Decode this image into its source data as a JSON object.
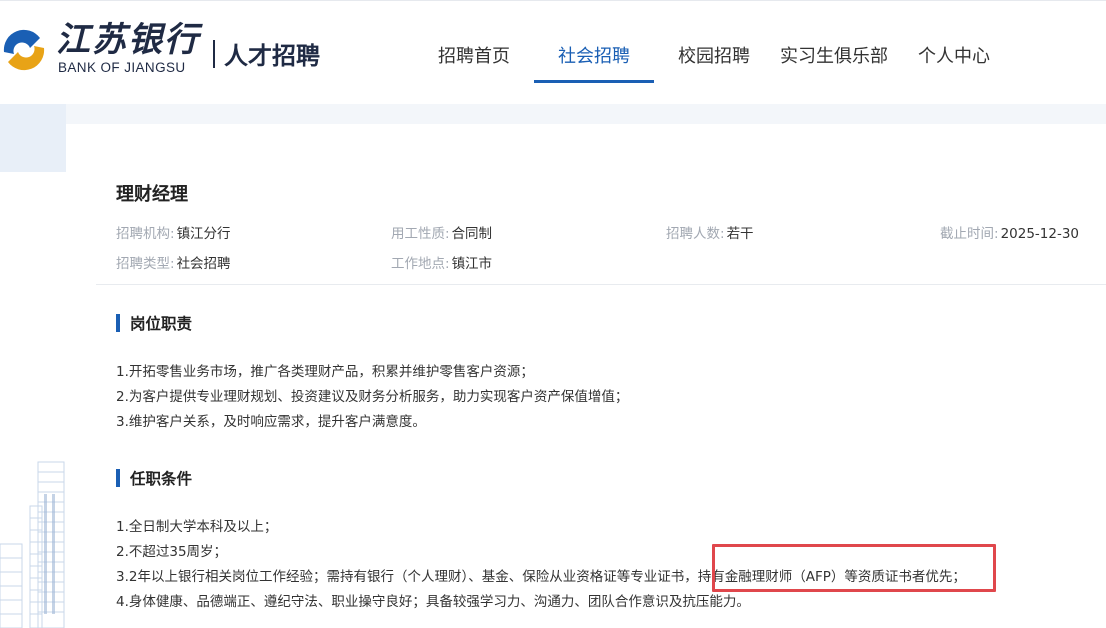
{
  "brand": {
    "name_cn": "江苏银行",
    "name_en": "BANK OF JIANGSU",
    "site_name": "人才招聘",
    "accent_color": "#1a5fb4",
    "logo_gold": "#e8a317",
    "logo_blue": "#1a5fb4"
  },
  "nav": {
    "items": [
      {
        "label": "招聘首页",
        "active": false
      },
      {
        "label": "社会招聘",
        "active": true
      },
      {
        "label": "校园招聘",
        "active": false
      },
      {
        "label": "实习生俱乐部",
        "active": false
      },
      {
        "label": "个人中心",
        "active": false
      }
    ]
  },
  "job": {
    "title": "理财经理",
    "meta": [
      {
        "label": "招聘机构:",
        "value": "镇江分行"
      },
      {
        "label": "用工性质:",
        "value": "合同制"
      },
      {
        "label": "招聘人数:",
        "value": "若干"
      },
      {
        "label": "截止时间:",
        "value": "2025-12-30"
      },
      {
        "label": "招聘类型:",
        "value": "社会招聘"
      },
      {
        "label": "工作地点:",
        "value": "镇江市"
      }
    ]
  },
  "sections": [
    {
      "title": "岗位职责",
      "lines": [
        "1.开拓零售业务市场，推广各类理财产品，积累并维护零售客户资源；",
        "2.为客户提供专业理财规划、投资建议及财务分析服务，助力实现客户资产保值增值；",
        "3.维护客户关系，及时响应需求，提升客户满意度。"
      ]
    },
    {
      "title": "任职条件",
      "lines": [
        "1.全日制大学本科及以上；",
        "2.不超过35周岁；",
        "3.2年以上银行相关岗位工作经验；需持有银行（个人理财）、基金、保险从业资格证等专业证书，持有金融理财师（AFP）等资质证书者优先；",
        "4.身体健康、品德端正、遵纪守法、职业操守良好；具备较强学习力、沟通力、团队合作意识及抗压能力。"
      ]
    }
  ],
  "annotation": {
    "color": "#e0474c"
  }
}
